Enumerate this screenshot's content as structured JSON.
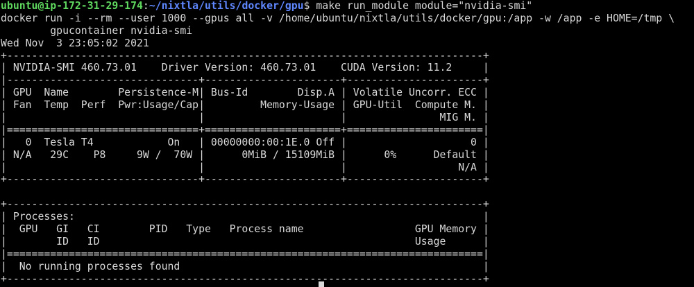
{
  "colors": {
    "background": "#000000",
    "foreground": "#d8d8d8",
    "prompt_user": "#5fd75f",
    "prompt_path": "#5f87ff"
  },
  "prompt": {
    "user_host": "ubuntu@ip-172-31-29-174",
    "separator": ":",
    "path": "~/nixtla/utils/docker/gpu",
    "symbol": "$",
    "command": " make run_module module=\"nvidia-smi\""
  },
  "output_lines": [
    "docker run -i --rm --user 1000 --gpus all -v /home/ubuntu/nixtla/utils/docker/gpu:/app -w /app -e HOME=/tmp \\",
    "        gpucontainer nvidia-smi",
    "Wed Nov  3 23:05:02 2021",
    "+-----------------------------------------------------------------------------+",
    "| NVIDIA-SMI 460.73.01    Driver Version: 460.73.01    CUDA Version: 11.2     |",
    "|-------------------------------+----------------------+----------------------+",
    "| GPU  Name        Persistence-M| Bus-Id        Disp.A | Volatile Uncorr. ECC |",
    "| Fan  Temp  Perf  Pwr:Usage/Cap|         Memory-Usage | GPU-Util  Compute M. |",
    "|                               |                      |               MIG M. |",
    "|===============================+======================+======================|",
    "|   0  Tesla T4            On   | 00000000:00:1E.0 Off |                    0 |",
    "| N/A   29C    P8     9W /  70W |      0MiB / 15109MiB |      0%      Default |",
    "|                               |                      |                  N/A |",
    "+-------------------------------+----------------------+----------------------+",
    "",
    "+-----------------------------------------------------------------------------+",
    "| Processes:                                                                  |",
    "|  GPU   GI   CI        PID   Type   Process name                  GPU Memory |",
    "|        ID   ID                                                   Usage      |",
    "|=============================================================================|",
    "|  No running processes found                                                 |",
    "+-----------------------------------------------------------------------------+"
  ]
}
